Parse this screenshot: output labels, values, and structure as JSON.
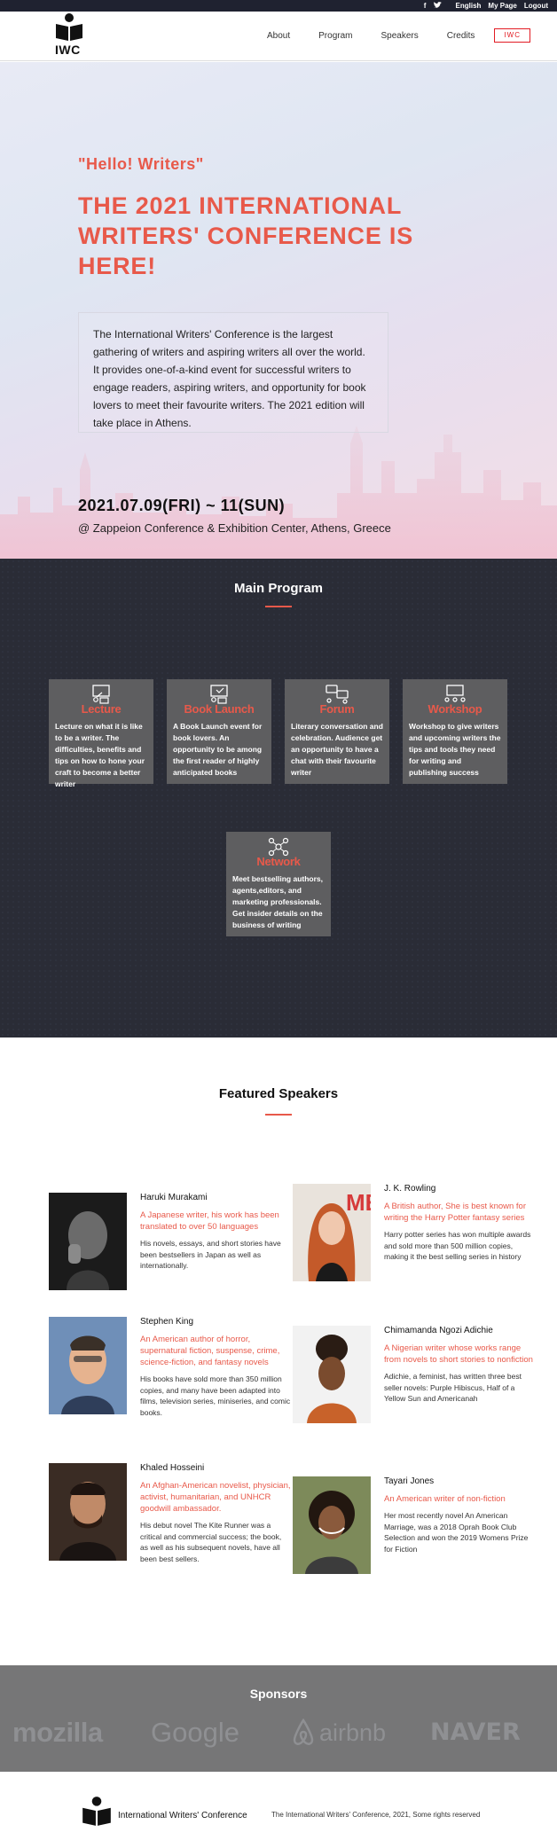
{
  "topbar": {
    "social": [
      "facebook-icon",
      "twitter-icon"
    ],
    "links": [
      "English",
      "My Page",
      "Logout"
    ]
  },
  "header": {
    "logo_text": "IWC",
    "nav": [
      "About",
      "Program",
      "Speakers",
      "Credits"
    ],
    "nav_highlight": "IWC"
  },
  "hero": {
    "hello": "\"Hello! Writers\"",
    "title": "THE 2021 INTERNATIONAL WRITERS' CONFERENCE IS HERE!",
    "description": "The International Writers' Conference is the largest gathering of writers and aspiring writers all over the world. It provides one-of-a-kind event for successful writers to engage readers, aspiring writers, and opportunity for book lovers to meet their favourite writers. The 2021 edition will take place in Athens.",
    "date": "2021.07.09(FRI) ~ 11(SUN)",
    "venue": "@ Zappeion Conference & Exhibition Center, Athens, Greece"
  },
  "program": {
    "heading": "Main Program",
    "cards": [
      {
        "title": "Lecture",
        "text": "Lecture on what it is like to be a writer. The difficulties, benefits and tips on how to hone your craft to become a better writer"
      },
      {
        "title": "Book Launch",
        "text": "A Book Launch event for book lovers. An opportunity to be among the first reader of highly anticipated books"
      },
      {
        "title": "Forum",
        "text": "Literary conversation and celebration. Audience get an opportunity to have a chat with their favourite writer"
      },
      {
        "title": "Workshop",
        "text": "Workshop to give writers and upcoming writers the tips and tools they need for writing and publishing success"
      },
      {
        "title": "Network",
        "text": "Meet bestselling authors, agents,editors, and marketing professionals. Get insider details on the business of writing"
      }
    ]
  },
  "speakers": {
    "heading": "Featured Speakers",
    "list": [
      {
        "name": "Haruki Murakami",
        "tag": "A Japanese writer, his work has been translated to over 50 languages",
        "bio": "His novels, essays, and short stories have been bestsellers in Japan as well as internationally."
      },
      {
        "name": "J. K. Rowling",
        "tag": "A British author, She is best known for writing the Harry Potter fantasy series",
        "bio": "Harry potter series has won multiple awards and sold more than 500 million copies, making it the best selling series in history"
      },
      {
        "name": "Stephen King",
        "tag": "An American author of horror, supernatural fiction, suspense, crime, science-fiction, and fantasy novels",
        "bio": "His books have sold more than 350 million copies, and many have been adapted into films, television series, miniseries, and comic books."
      },
      {
        "name": "Chimamanda Ngozi Adichie",
        "tag": "A Nigerian writer whose works range from novels to short stories to nonfiction",
        "bio": "Adichie, a feminist, has written three best seller novels: Purple Hibiscus, Half of a Yellow Sun and Americanah"
      },
      {
        "name": "Khaled Hosseini",
        "tag": "An Afghan-American novelist, physician, activist, humanitarian, and UNHCR goodwill ambassador.",
        "bio": "His debut novel The Kite Runner was a critical and commercial success; the book, as well as his subsequent novels, have all been best sellers."
      },
      {
        "name": "Tayari Jones",
        "tag": "An American writer of non-fiction",
        "bio": "Her most recently novel An American Marriage, was a 2018 Oprah Book Club Selection and won the 2019 Womens Prize for Fiction"
      }
    ]
  },
  "sponsors": {
    "heading": "Sponsors",
    "logos": [
      "mozilla",
      "Google",
      "airbnb",
      "NAVER"
    ]
  },
  "footer": {
    "name": "International Writers' Conference",
    "copyright": "The International Writers' Conference, 2021, Some rights reserved"
  },
  "colors": {
    "accent": "#e8594a",
    "dark": "#2a2c36",
    "card": "#5e5e60",
    "sponsor_bg": "#767677"
  }
}
